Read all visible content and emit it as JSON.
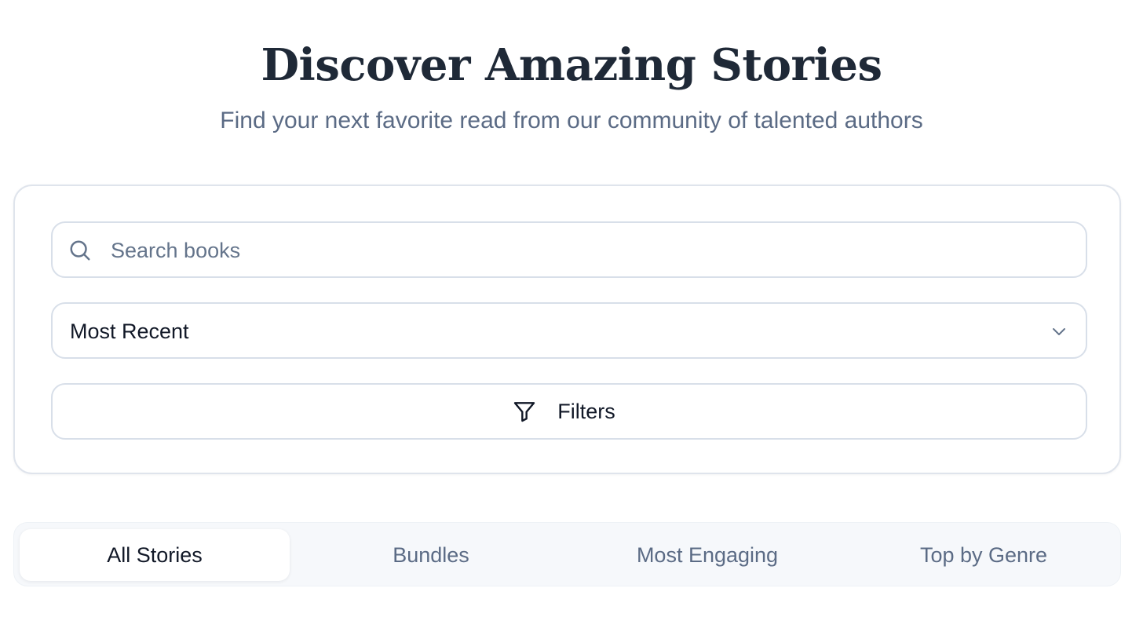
{
  "header": {
    "title": "Discover Amazing Stories",
    "subtitle": "Find your next favorite read from our community of talented authors"
  },
  "search": {
    "placeholder": "Search books",
    "value": "",
    "icon": "search-icon"
  },
  "sort": {
    "selected": "Most Recent",
    "icon": "chevron-down-icon"
  },
  "filters": {
    "label": "Filters",
    "icon": "filter-icon"
  },
  "tabs": [
    {
      "label": "All Stories",
      "active": true
    },
    {
      "label": "Bundles",
      "active": false
    },
    {
      "label": "Most Engaging",
      "active": false
    },
    {
      "label": "Top by Genre",
      "active": false
    }
  ],
  "colors": {
    "heading": "#1f2937",
    "muted_text": "#5b6b85",
    "border": "#d8dfe9",
    "tab_bar_background": "#f6f8fb",
    "active_tab_background": "#ffffff"
  }
}
